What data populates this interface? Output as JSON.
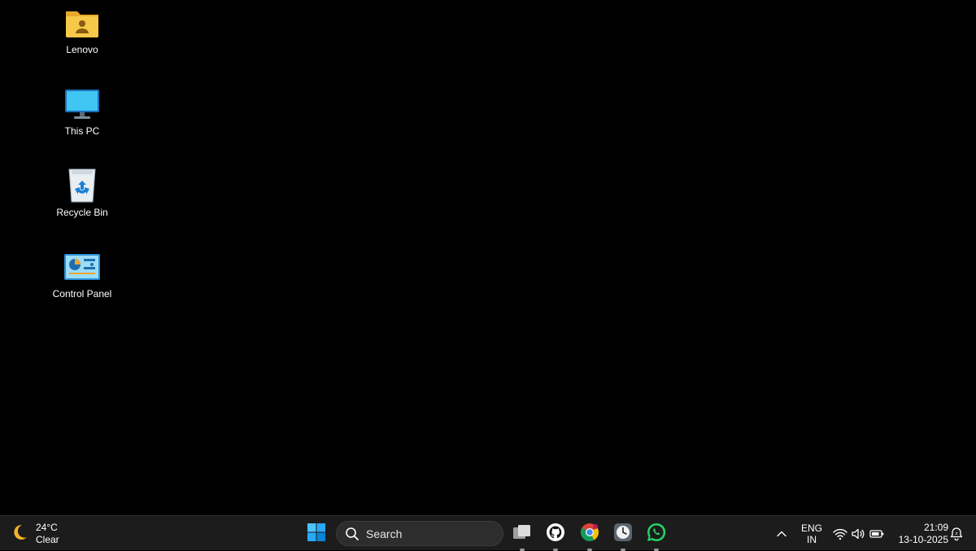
{
  "desktop": {
    "icons": [
      {
        "label": "Lenovo",
        "icon": "user-folder-icon"
      },
      {
        "label": "This PC",
        "icon": "monitor-icon"
      },
      {
        "label": "Recycle Bin",
        "icon": "recycle-bin-icon"
      },
      {
        "label": "Control Panel",
        "icon": "control-panel-icon"
      }
    ]
  },
  "taskbar": {
    "weather": {
      "temperature": "24°C",
      "condition": "Clear",
      "icon": "moon-icon"
    },
    "start_icon": "windows-start-icon",
    "search": {
      "placeholder": "Search"
    },
    "apps": [
      {
        "name": "Task View",
        "icon": "task-view-icon"
      },
      {
        "name": "GitHub Desktop",
        "icon": "github-icon"
      },
      {
        "name": "Google Chrome",
        "icon": "chrome-icon"
      },
      {
        "name": "Clock",
        "icon": "clock-icon"
      },
      {
        "name": "WhatsApp",
        "icon": "whatsapp-icon"
      }
    ],
    "tray": {
      "language_line1": "ENG",
      "language_line2": "IN",
      "time": "21:09",
      "date": "13-10-2025"
    }
  },
  "colors": {
    "desktop_bg": "#000000",
    "taskbar_bg": "#1c1c1c",
    "accent_blue": "#0a84d8",
    "whatsapp_green": "#25d366"
  }
}
